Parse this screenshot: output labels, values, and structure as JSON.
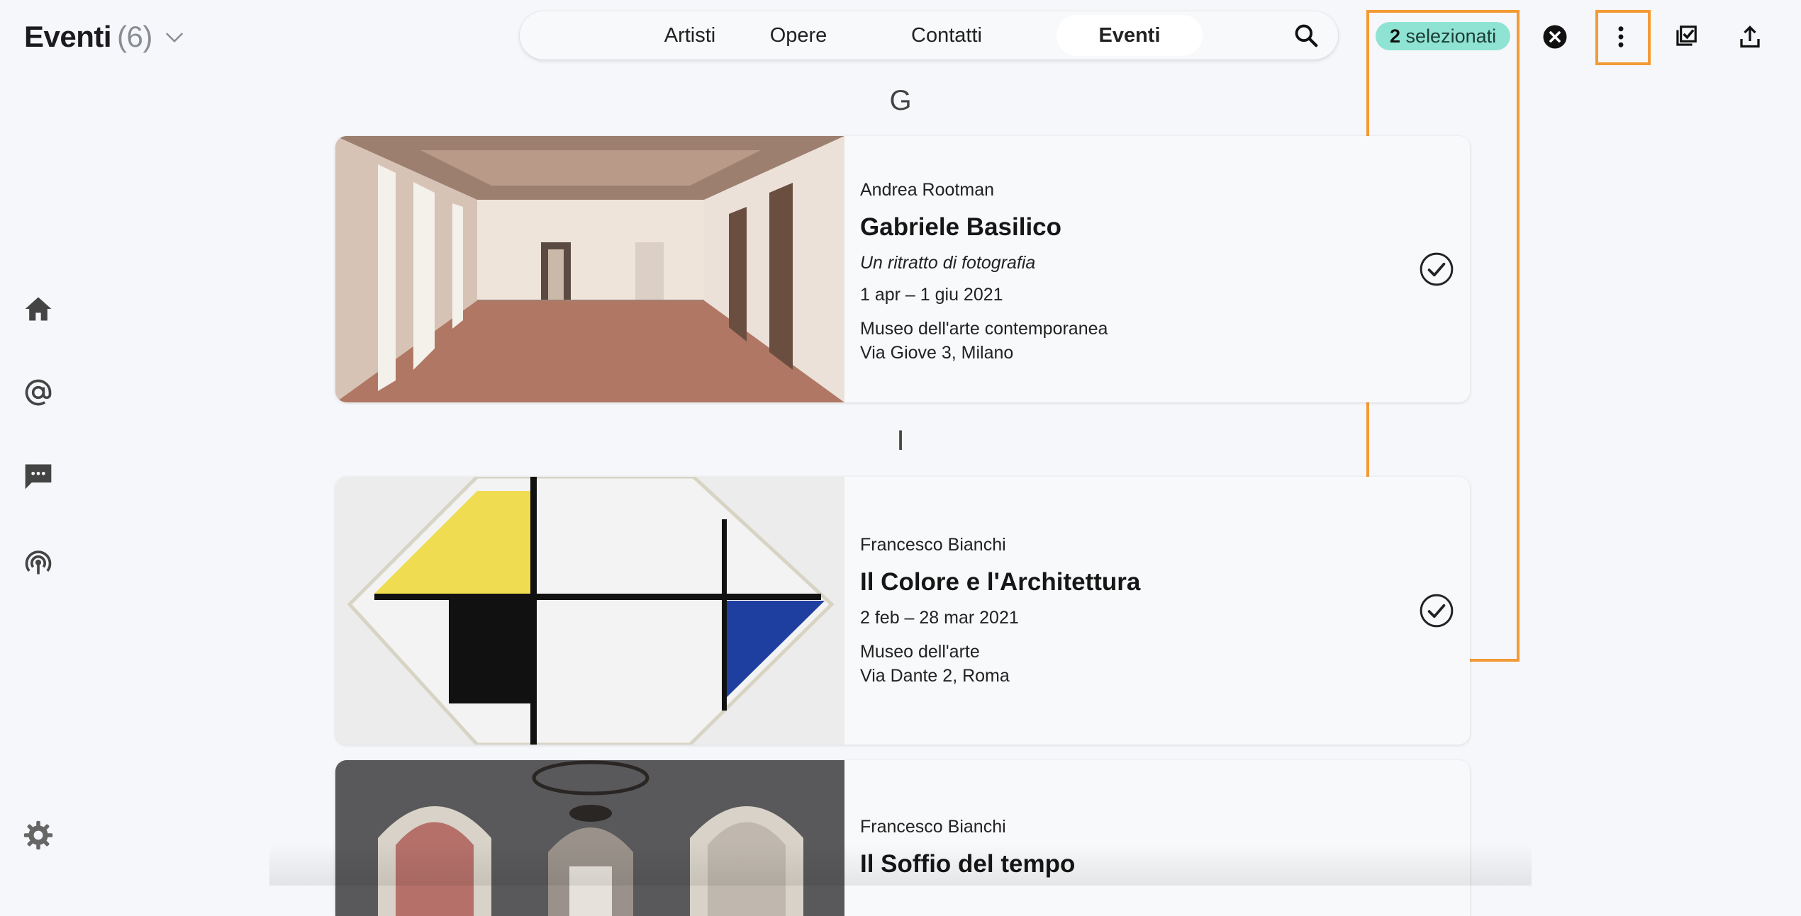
{
  "header": {
    "title": "Eventi",
    "count": "(6)",
    "tabs": [
      {
        "label": "Artisti",
        "active": false
      },
      {
        "label": "Opere",
        "active": false
      },
      {
        "label": "Contatti",
        "active": false
      },
      {
        "label": "Eventi",
        "active": true
      }
    ],
    "selection": {
      "count": "2",
      "label": "selezionati"
    }
  },
  "colors": {
    "accent_badge": "#8fe3d3",
    "highlight": "#f39a36",
    "background": "#f6f7fa"
  },
  "icons": {
    "sidebar": [
      "home-icon",
      "at-icon",
      "chat-icon",
      "broadcast-icon",
      "settings-icon"
    ],
    "toolbar": [
      "search-icon",
      "close-icon",
      "more-vertical-icon",
      "select-all-icon",
      "export-icon"
    ]
  },
  "sections": [
    {
      "letter": "G",
      "events": [
        {
          "artist": "Andrea Rootman",
          "title": "Gabriele Basilico",
          "subtitle": "Un ritratto di fotografia",
          "dates": "1 apr – 1 giu 2021",
          "venue": "Museo dell'arte contemporanea",
          "address": "Via Giove 3, Milano",
          "selected": true
        }
      ]
    },
    {
      "letter": "I",
      "events": [
        {
          "artist": "Francesco Bianchi",
          "title": "Il Colore e l'Architettura",
          "dates": "2 feb – 28 mar 2021",
          "venue": "Museo dell'arte",
          "address": "Via Dante 2, Roma",
          "selected": true
        },
        {
          "artist": "Francesco Bianchi",
          "title": "Il Soffio del tempo",
          "selected": false
        }
      ]
    }
  ]
}
